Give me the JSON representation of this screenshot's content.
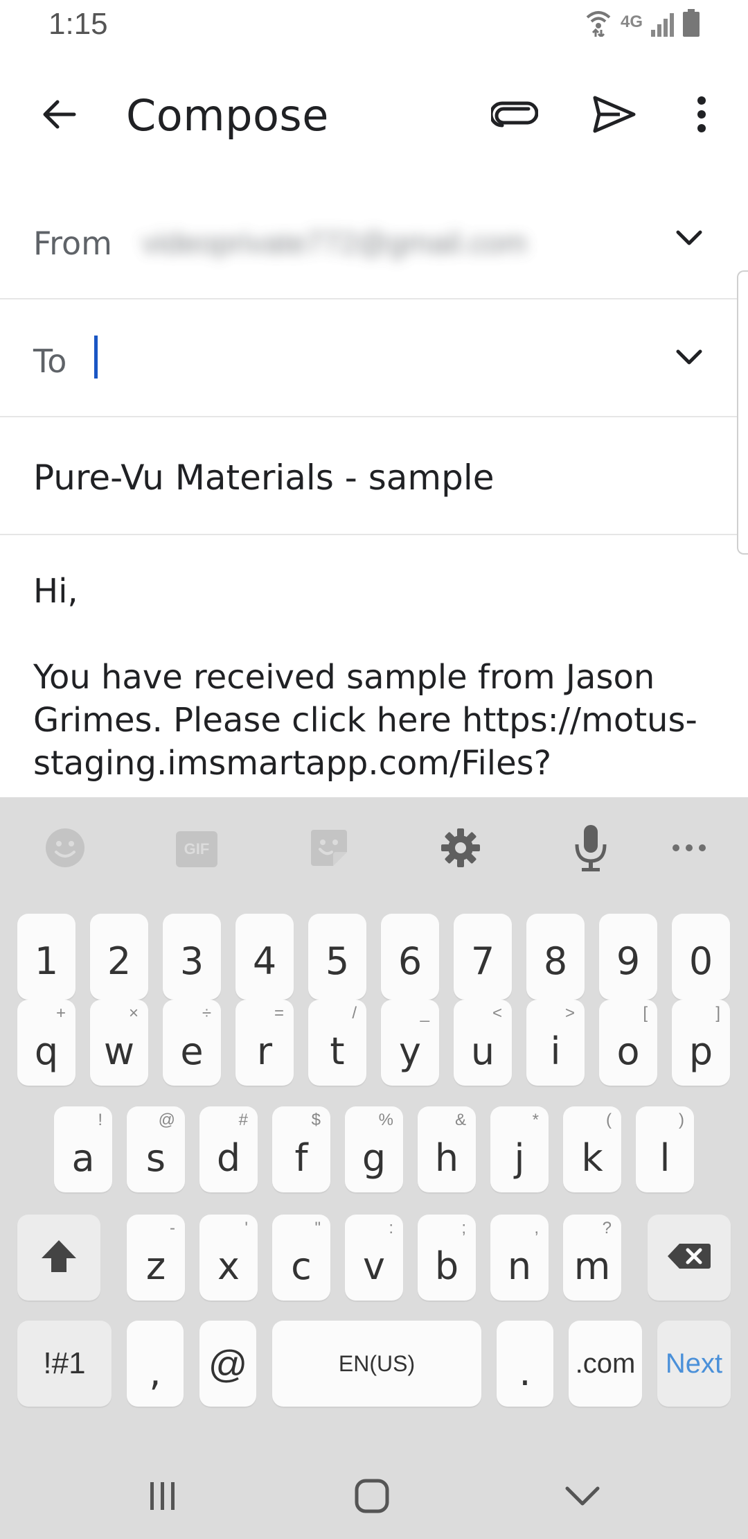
{
  "status_bar": {
    "time": "1:15",
    "network_label": "4G"
  },
  "app_bar": {
    "title": "Compose"
  },
  "compose": {
    "from_label": "From",
    "from_value": "videoprivate772@gmail.com",
    "to_label": "To",
    "to_value": "",
    "subject": "Pure-Vu Materials - sample",
    "body_greeting": "Hi,",
    "body_text": "You have received sample from Jason Grimes. Please click here https://motus-staging.imsmartapp.com/Files?"
  },
  "keyboard": {
    "number_row": [
      "1",
      "2",
      "3",
      "4",
      "5",
      "6",
      "7",
      "8",
      "9",
      "0"
    ],
    "row1": [
      {
        "key": "q",
        "hint": "+"
      },
      {
        "key": "w",
        "hint": "×"
      },
      {
        "key": "e",
        "hint": "÷"
      },
      {
        "key": "r",
        "hint": "="
      },
      {
        "key": "t",
        "hint": "/"
      },
      {
        "key": "y",
        "hint": "_"
      },
      {
        "key": "u",
        "hint": "<"
      },
      {
        "key": "i",
        "hint": ">"
      },
      {
        "key": "o",
        "hint": "["
      },
      {
        "key": "p",
        "hint": "]"
      }
    ],
    "row2": [
      {
        "key": "a",
        "hint": "!"
      },
      {
        "key": "s",
        "hint": "@"
      },
      {
        "key": "d",
        "hint": "#"
      },
      {
        "key": "f",
        "hint": "$"
      },
      {
        "key": "g",
        "hint": "%"
      },
      {
        "key": "h",
        "hint": "&"
      },
      {
        "key": "j",
        "hint": "*"
      },
      {
        "key": "k",
        "hint": "("
      },
      {
        "key": "l",
        "hint": ")"
      }
    ],
    "row3": [
      {
        "key": "z",
        "hint": "-"
      },
      {
        "key": "x",
        "hint": "'"
      },
      {
        "key": "c",
        "hint": "\""
      },
      {
        "key": "v",
        "hint": ":"
      },
      {
        "key": "b",
        "hint": ";"
      },
      {
        "key": "n",
        "hint": ","
      },
      {
        "key": "m",
        "hint": "?"
      }
    ],
    "symbols_label": "!#1",
    "comma": ",",
    "at": "@",
    "space_label": "EN(US)",
    "period": ".",
    "dotcom": ".com",
    "next_label": "Next",
    "toolbar_gif": "GIF"
  },
  "colors": {
    "accent": "#1a56c4",
    "next": "#4a90d9",
    "keyboard_bg": "#dcdcdc"
  }
}
